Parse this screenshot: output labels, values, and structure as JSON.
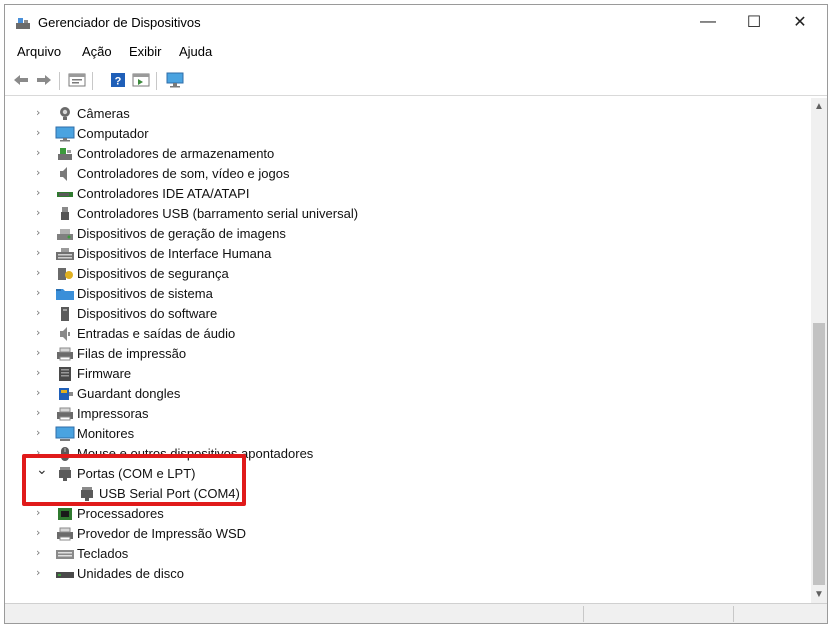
{
  "window": {
    "title": "Gerenciador de Dispositivos",
    "controls": {
      "minimize": "—",
      "maximize": "☐",
      "close": "✕"
    }
  },
  "menu": [
    "Arquivo",
    "Ação",
    "Exibir",
    "Ajuda"
  ],
  "toolbar": {
    "buttons": [
      "back-icon",
      "forward-icon",
      "properties-icon",
      "help-icon",
      "view-icon",
      "monitor-icon"
    ]
  },
  "tree": {
    "items": [
      {
        "label": "Câmeras",
        "icon": "camera-icon",
        "expanded": false
      },
      {
        "label": "Computador",
        "icon": "computer-icon",
        "expanded": false
      },
      {
        "label": "Controladores de armazenamento",
        "icon": "storage-controller-icon",
        "expanded": false
      },
      {
        "label": "Controladores de som, vídeo e jogos",
        "icon": "speaker-icon",
        "expanded": false
      },
      {
        "label": "Controladores IDE ATA/ATAPI",
        "icon": "ide-icon",
        "expanded": false
      },
      {
        "label": "Controladores USB (barramento serial universal)",
        "icon": "usb-icon",
        "expanded": false
      },
      {
        "label": "Dispositivos de geração de imagens",
        "icon": "imaging-icon",
        "expanded": false
      },
      {
        "label": "Dispositivos de Interface Humana",
        "icon": "hid-icon",
        "expanded": false
      },
      {
        "label": "Dispositivos de segurança",
        "icon": "security-icon",
        "expanded": false
      },
      {
        "label": "Dispositivos de sistema",
        "icon": "system-folder-icon",
        "expanded": false
      },
      {
        "label": "Dispositivos do software",
        "icon": "software-device-icon",
        "expanded": false
      },
      {
        "label": "Entradas e saídas de áudio",
        "icon": "audio-icon",
        "expanded": false
      },
      {
        "label": "Filas de impressão",
        "icon": "print-queue-icon",
        "expanded": false
      },
      {
        "label": "Firmware",
        "icon": "firmware-icon",
        "expanded": false
      },
      {
        "label": "Guardant dongles",
        "icon": "dongle-icon",
        "expanded": false
      },
      {
        "label": "Impressoras",
        "icon": "printer-icon",
        "expanded": false
      },
      {
        "label": "Monitores",
        "icon": "monitor-icon",
        "expanded": false
      },
      {
        "label": "Mouse e outros dispositivos apontadores",
        "icon": "mouse-icon",
        "expanded": false
      },
      {
        "label": "Portas (COM e LPT)",
        "icon": "port-icon",
        "expanded": true
      },
      {
        "label": "USB Serial Port (COM4)",
        "icon": "port-icon",
        "child": true
      },
      {
        "label": "Processadores",
        "icon": "processor-icon",
        "expanded": false
      },
      {
        "label": "Provedor de Impressão WSD",
        "icon": "printer-icon",
        "expanded": false
      },
      {
        "label": "Teclados",
        "icon": "keyboard-icon",
        "expanded": false
      },
      {
        "label": "Unidades de disco",
        "icon": "disk-icon",
        "expanded": false
      }
    ]
  },
  "colors": {
    "highlight": "#e01a1a",
    "folder_blue": "#3a8fd9",
    "chevron": "#7a7a7a"
  }
}
